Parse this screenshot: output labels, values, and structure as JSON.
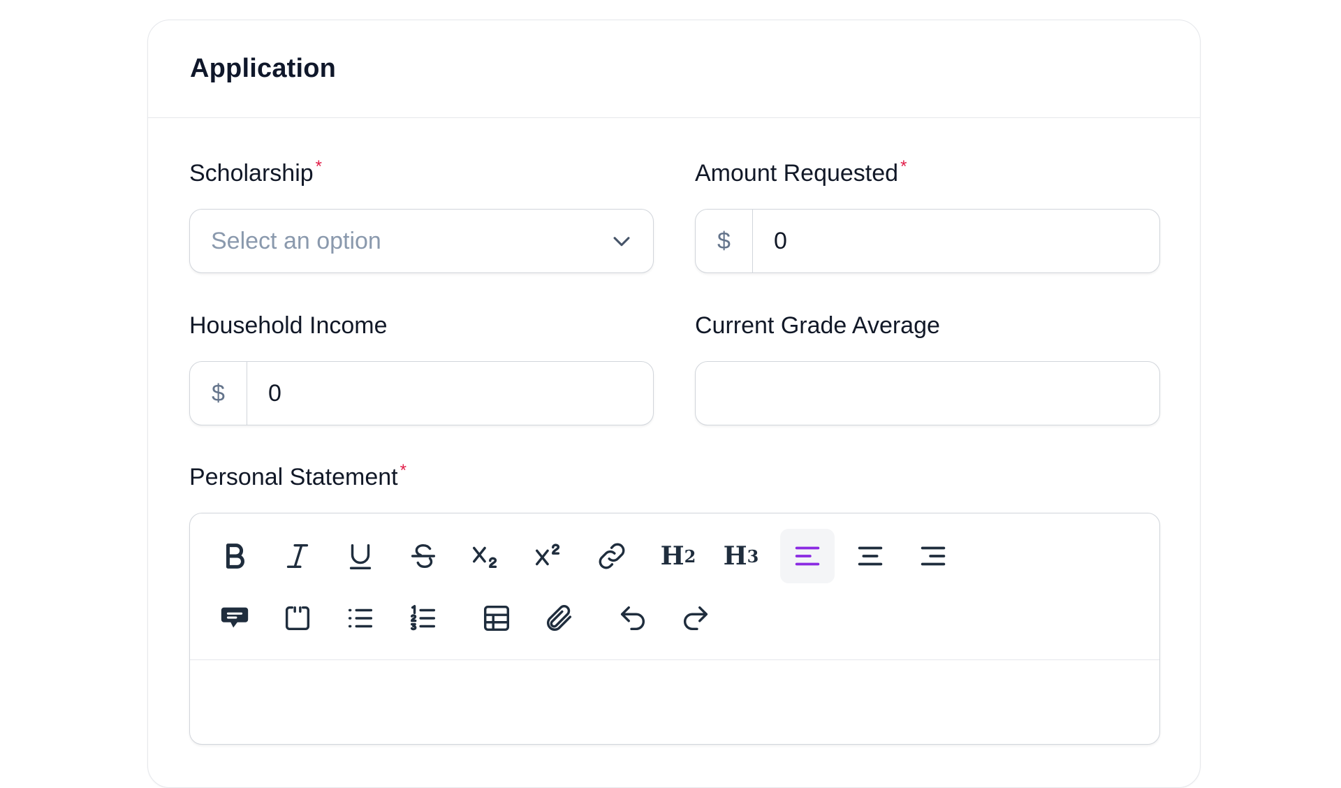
{
  "card": {
    "title": "Application"
  },
  "fields": {
    "scholarship": {
      "label": "Scholarship",
      "required_mark": "*",
      "placeholder": "Select an option"
    },
    "amount_requested": {
      "label": "Amount Requested",
      "required_mark": "*",
      "prefix": "$",
      "value": "0"
    },
    "household_income": {
      "label": "Household Income",
      "prefix": "$",
      "value": "0"
    },
    "current_grade_average": {
      "label": "Current Grade Average",
      "value": ""
    },
    "personal_statement": {
      "label": "Personal Statement",
      "required_mark": "*"
    }
  },
  "toolbar": {
    "h2": "H",
    "h2_sub": "2",
    "h3": "H",
    "h3_sub": "3",
    "active_tool": "align-left",
    "accent_color": "#8b2be2"
  }
}
